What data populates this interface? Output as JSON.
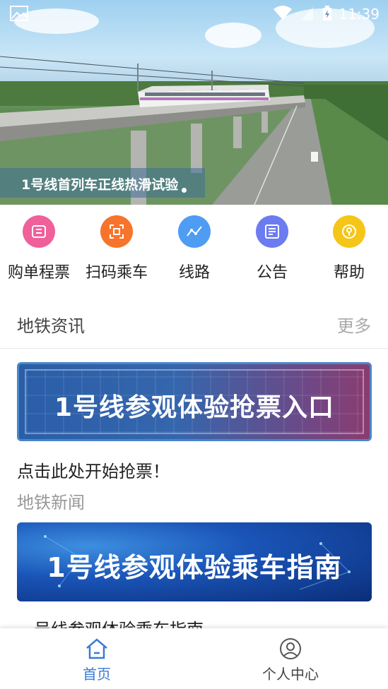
{
  "status_bar": {
    "time": "11:39"
  },
  "banner": {
    "caption": "1号线首列车正线热滑试验"
  },
  "quick_menu": [
    {
      "label": "购单程票",
      "icon": "ticket-icon",
      "color": "#f0609a"
    },
    {
      "label": "扫码乘车",
      "icon": "scan-icon",
      "color": "#f7742c"
    },
    {
      "label": "线路",
      "icon": "route-icon",
      "color": "#4f9cf3"
    },
    {
      "label": "公告",
      "icon": "announcement-icon",
      "color": "#6b7cf2"
    },
    {
      "label": "帮助",
      "icon": "help-icon",
      "color": "#f5c518"
    }
  ],
  "news": {
    "title": "地铁资讯",
    "more": "更多",
    "items": [
      {
        "banner_text": "1号线参观体验抢票入口",
        "title": "点击此处开始抢票！",
        "category": "地铁新闻"
      },
      {
        "banner_text": "1号线参观体验乘车指南",
        "title": "一号线参观体验乘车指南"
      }
    ]
  },
  "tabbar": {
    "home": "首页",
    "profile": "个人中心",
    "active_color": "#3a7bd5"
  }
}
